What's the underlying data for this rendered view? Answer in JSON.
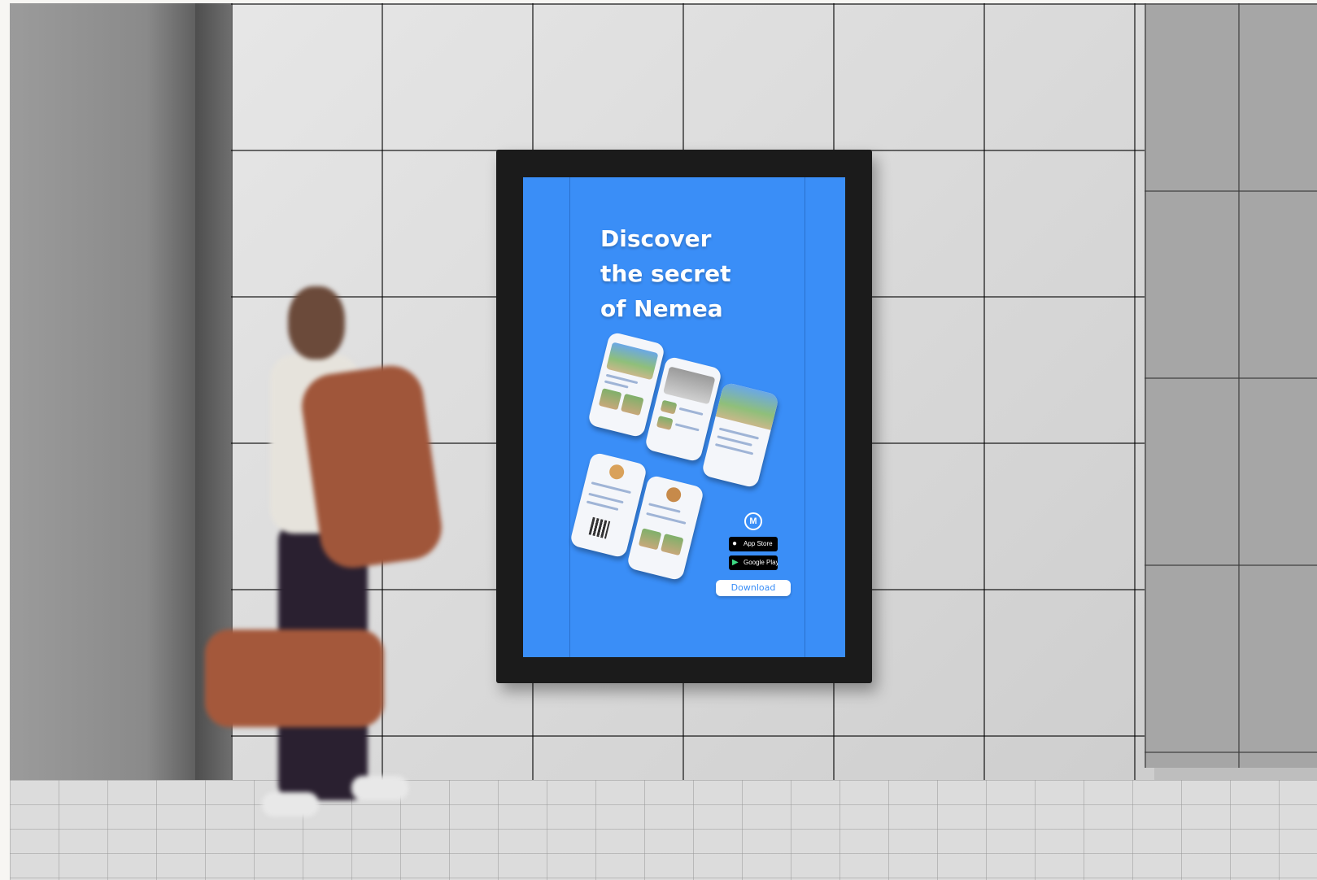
{
  "poster": {
    "headline_lines": [
      "Discover",
      "the secret",
      "of Nemea"
    ],
    "logo_letter": "M",
    "app_store_label": "App Store",
    "google_play_label": "Google Play",
    "download_label": "Download",
    "background_color": "#3a8ef7"
  },
  "icons": {
    "apple": "apple-icon",
    "play": "google-play-icon",
    "logo": "nemea-logo-icon"
  }
}
